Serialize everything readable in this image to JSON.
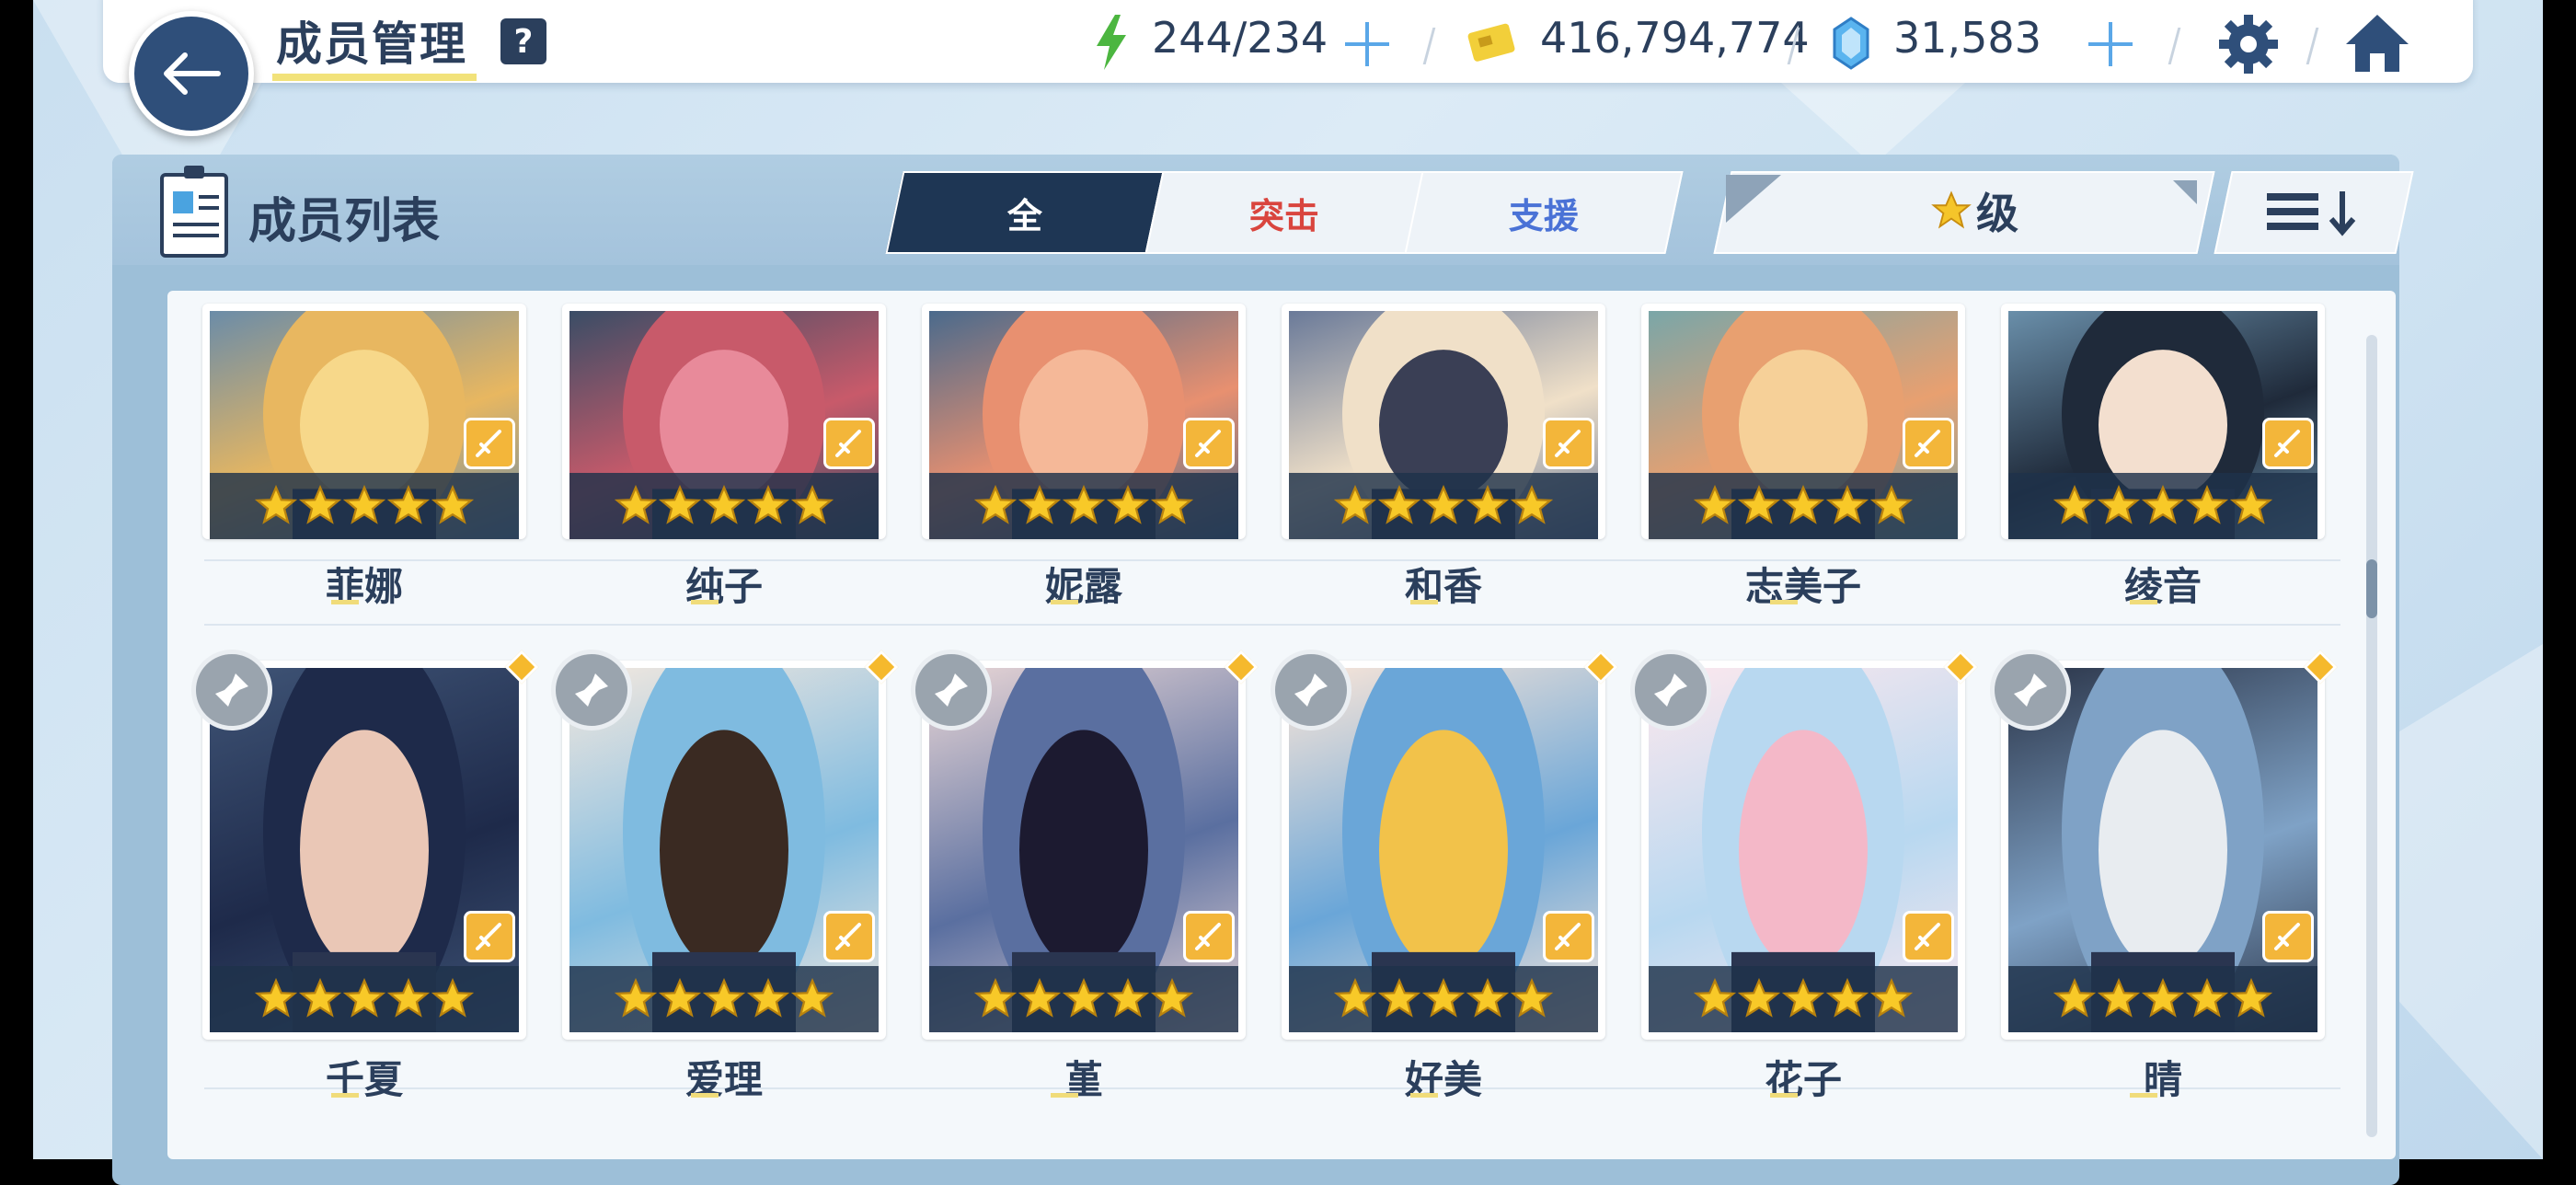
{
  "header": {
    "title": "成员管理",
    "help_label": "?",
    "stamina": "244/234",
    "credits": "416,794,774",
    "gems": "31,583"
  },
  "panel": {
    "title": "成员列表",
    "tabs": [
      {
        "label": "全",
        "state": "active"
      },
      {
        "label": "突击",
        "color": "#d9453e"
      },
      {
        "label": "支援",
        "color": "#4a72d6"
      }
    ],
    "sort_label": "级",
    "sort_icon": "star-icon"
  },
  "members_row1": [
    {
      "name": "菲娜",
      "stars": 5,
      "role_icon": "sword-icon"
    },
    {
      "name": "纯子",
      "stars": 5,
      "role_icon": "sword-icon"
    },
    {
      "name": "妮露",
      "stars": 5,
      "role_icon": "sword-icon"
    },
    {
      "name": "和香",
      "stars": 5,
      "role_icon": "sword-icon"
    },
    {
      "name": "志美子",
      "stars": 5,
      "role_icon": "sword-icon"
    },
    {
      "name": "绫音",
      "stars": 5,
      "role_icon": "sword-icon"
    }
  ],
  "members_row2": [
    {
      "name": "千夏",
      "stars": 5,
      "role_icon": "sword-icon",
      "pin_icon": "pin-icon"
    },
    {
      "name": "爱理",
      "stars": 5,
      "role_icon": "sword-icon",
      "pin_icon": "pin-icon"
    },
    {
      "name": "堇",
      "stars": 5,
      "role_icon": "sword-icon",
      "pin_icon": "pin-icon"
    },
    {
      "name": "好美",
      "stars": 5,
      "role_icon": "sword-icon",
      "pin_icon": "pin-icon"
    },
    {
      "name": "花子",
      "stars": 5,
      "role_icon": "sword-icon",
      "pin_icon": "pin-icon"
    },
    {
      "name": "晴",
      "stars": 5,
      "role_icon": "sword-icon",
      "pin_icon": "pin-icon"
    }
  ],
  "colors": {
    "navy": "#2b3f5c",
    "accent_gold": "#f3b63a",
    "assault_red": "#d9453e",
    "support_blue": "#4a72d6"
  }
}
